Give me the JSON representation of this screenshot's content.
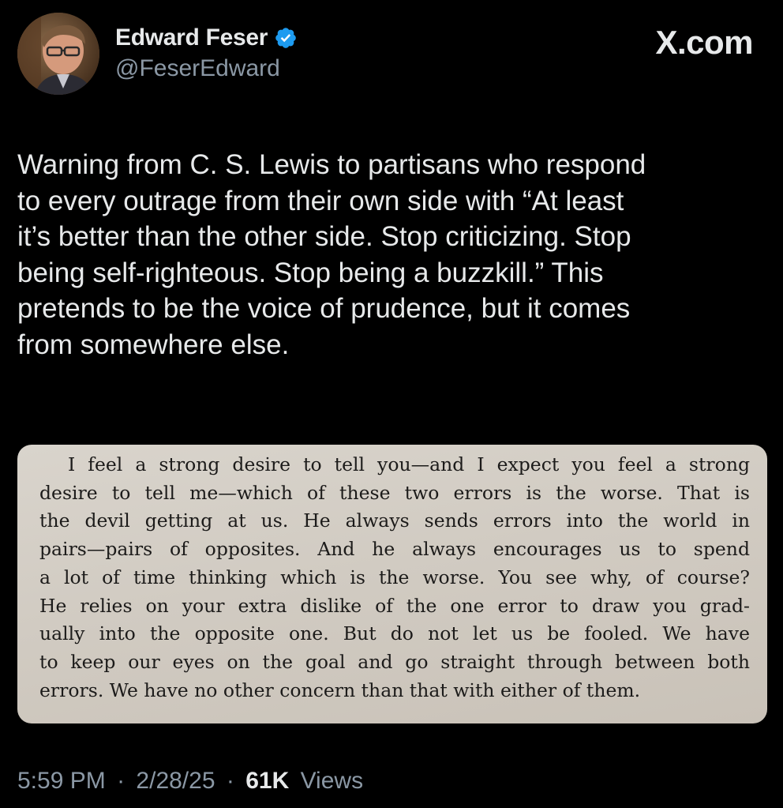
{
  "user": {
    "display_name": "Edward Feser",
    "handle": "@FeserEdward",
    "verified": true,
    "verified_badge_color": "#1d9bf0"
  },
  "brand": "X.com",
  "tweet": {
    "text": "Warning from C. S. Lewis to partisans who respond\nto every outrage from their own side with “At least\nit’s better than the other side. Stop criticizing. Stop\nbeing self-righteous. Stop being a buzzkill.” This\npretends to be the voice of prudence, but it comes\nfrom somewhere else."
  },
  "media": {
    "lines": [
      "I feel a strong desire to tell you—and I expect you feel a strong",
      "desire to tell me—which of these two errors is the worse. That is",
      "the devil getting at us. He always sends errors into the world in",
      "pairs—pairs of opposites. And he always encourages us to spend",
      "a lot of time thinking which is the worse. You see why, of course?",
      "He relies on your extra dislike of the one error to draw you grad-",
      "ually into the opposite one. But do not let us be fooled. We have",
      "to keep our eyes on the goal and go straight through between both",
      "errors. We have no other concern than that with either of them."
    ]
  },
  "footer": {
    "time": "5:59 PM",
    "separator": "·",
    "date": "2/28/25",
    "views_count": "61K",
    "views_label": "Views"
  },
  "icons": {
    "avatar": "avatar-photo",
    "verified": "verified-badge-icon"
  }
}
